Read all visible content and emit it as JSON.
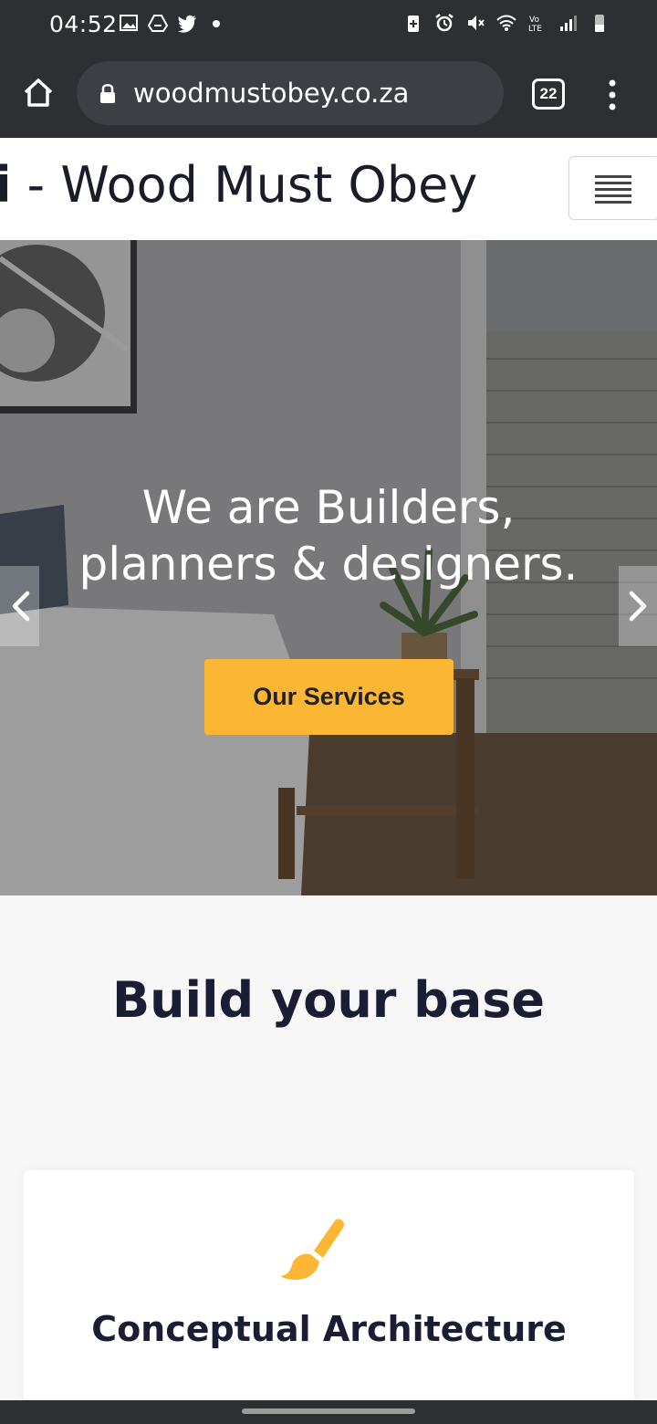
{
  "status_bar": {
    "time": "04:52",
    "left_icons": [
      "image-icon",
      "drive-icon",
      "twitter-icon",
      "dot-icon"
    ],
    "right_icons": [
      "battery-saver-icon",
      "alarm-icon",
      "mute-icon",
      "wifi-icon",
      "volte-icon",
      "signal-icon",
      "battery-icon"
    ]
  },
  "browser": {
    "url": "woodmustobey.co.za",
    "tab_count": "22"
  },
  "site": {
    "title_prefix": "i",
    "title_separator": " - ",
    "title": "Wood Must Obey"
  },
  "hero": {
    "heading_line1": "We are Builders,",
    "heading_line2": "planners & designers.",
    "cta_label": "Our Services"
  },
  "section": {
    "title": "Build your base"
  },
  "card": {
    "title": "Conceptual Architecture",
    "icon": "paintbrush-icon"
  },
  "colors": {
    "accent": "#fbb733",
    "heading": "#1a1d33",
    "chrome": "#2d2f33"
  }
}
